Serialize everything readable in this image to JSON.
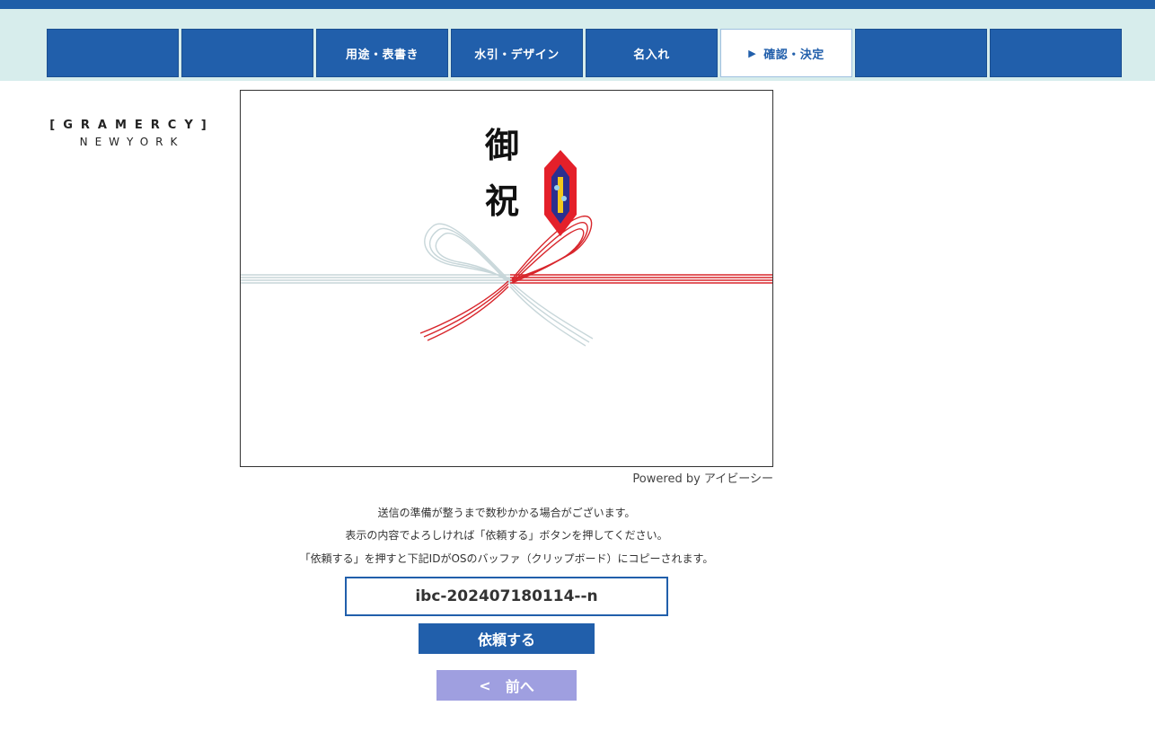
{
  "nav": {
    "tabs": [
      {
        "label": ""
      },
      {
        "label": ""
      },
      {
        "label": "用途・表書き"
      },
      {
        "label": "水引・デザイン"
      },
      {
        "label": "名入れ"
      },
      {
        "label": "確認・決定",
        "active": true,
        "marker": "▶"
      },
      {
        "label": ""
      },
      {
        "label": ""
      }
    ]
  },
  "logo": {
    "line1": "[GRAMERCY]",
    "line2": "NEWYORK"
  },
  "preview": {
    "omote": [
      "御",
      "祝"
    ],
    "mizuhiki_colors": {
      "left": "#c7d6d9",
      "right": "#d8262c"
    },
    "noshi_colors": {
      "outer": "#e4202a",
      "inner": "#2b2f8f",
      "accent": "#f2c81c"
    }
  },
  "powered_by": "Powered by アイビーシー",
  "notes": [
    "送信の準備が整うまで数秒かかる場合がございます。",
    "表示の内容でよろしければ「依頼する」ボタンを押してください。",
    "「依頼する」を押すと下記IDがOSのバッファ（クリップボード）にコピーされます。"
  ],
  "order_id": "ibc-202407180114--n",
  "request_button": "依頼する",
  "back_button": {
    "icon": "<",
    "label": "前へ"
  },
  "colors": {
    "brand": "#215fab",
    "nav_bg": "#d7edec",
    "back_button": "#9f9fe0"
  }
}
